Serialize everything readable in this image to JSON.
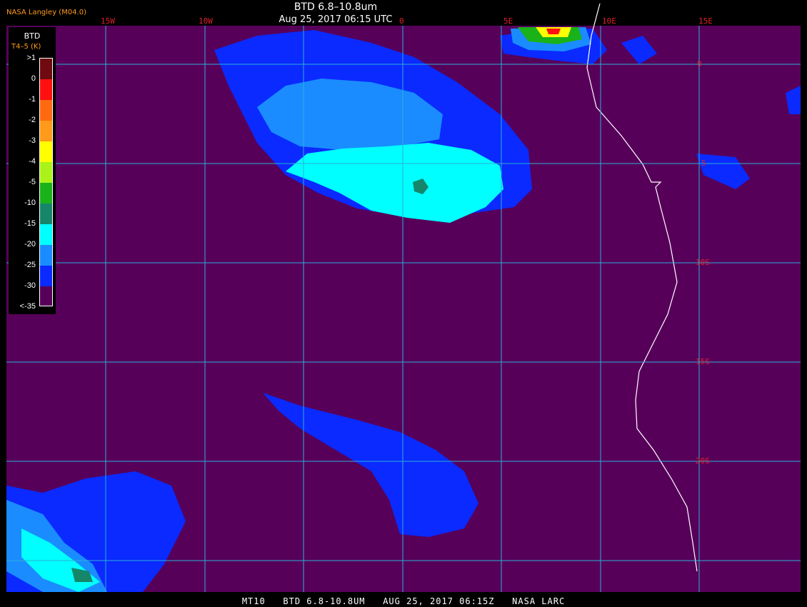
{
  "header": {
    "credit": "NASA Langley (M04.0)",
    "title": "BTD 6.8–10.8um",
    "subtitle": "Aug 25, 2017 06:15 UTC"
  },
  "longitude_labels": [
    "15W",
    "10W",
    "0",
    "5E",
    "10E",
    "15E"
  ],
  "latitude_labels": [
    "0",
    "5",
    "10S",
    "15S",
    "20S"
  ],
  "legend": {
    "title": "BTD",
    "unit": "T4–5 (K)",
    "labels": [
      ">1",
      "0",
      "-1",
      "-2",
      "-3",
      "-4",
      "-5",
      "-10",
      "-15",
      "-20",
      "-25",
      "-30",
      "<-35"
    ],
    "colors": [
      "#6e0a10",
      "#ff1010",
      "#ff6a10",
      "#ff9a1a",
      "#ffff00",
      "#aaf21a",
      "#19b219",
      "#16866a",
      "#00ffff",
      "#1a8cff",
      "#0a2aff",
      "#57005a"
    ]
  },
  "colors": {
    "background": "#57005a",
    "grid": "#28b0d8",
    "coast": "#ffffff",
    "label": "#e0202a"
  },
  "footer": "MT10   BTD 6.8-10.8UM   AUG 25, 2017 06:15Z   NASA LARC"
}
